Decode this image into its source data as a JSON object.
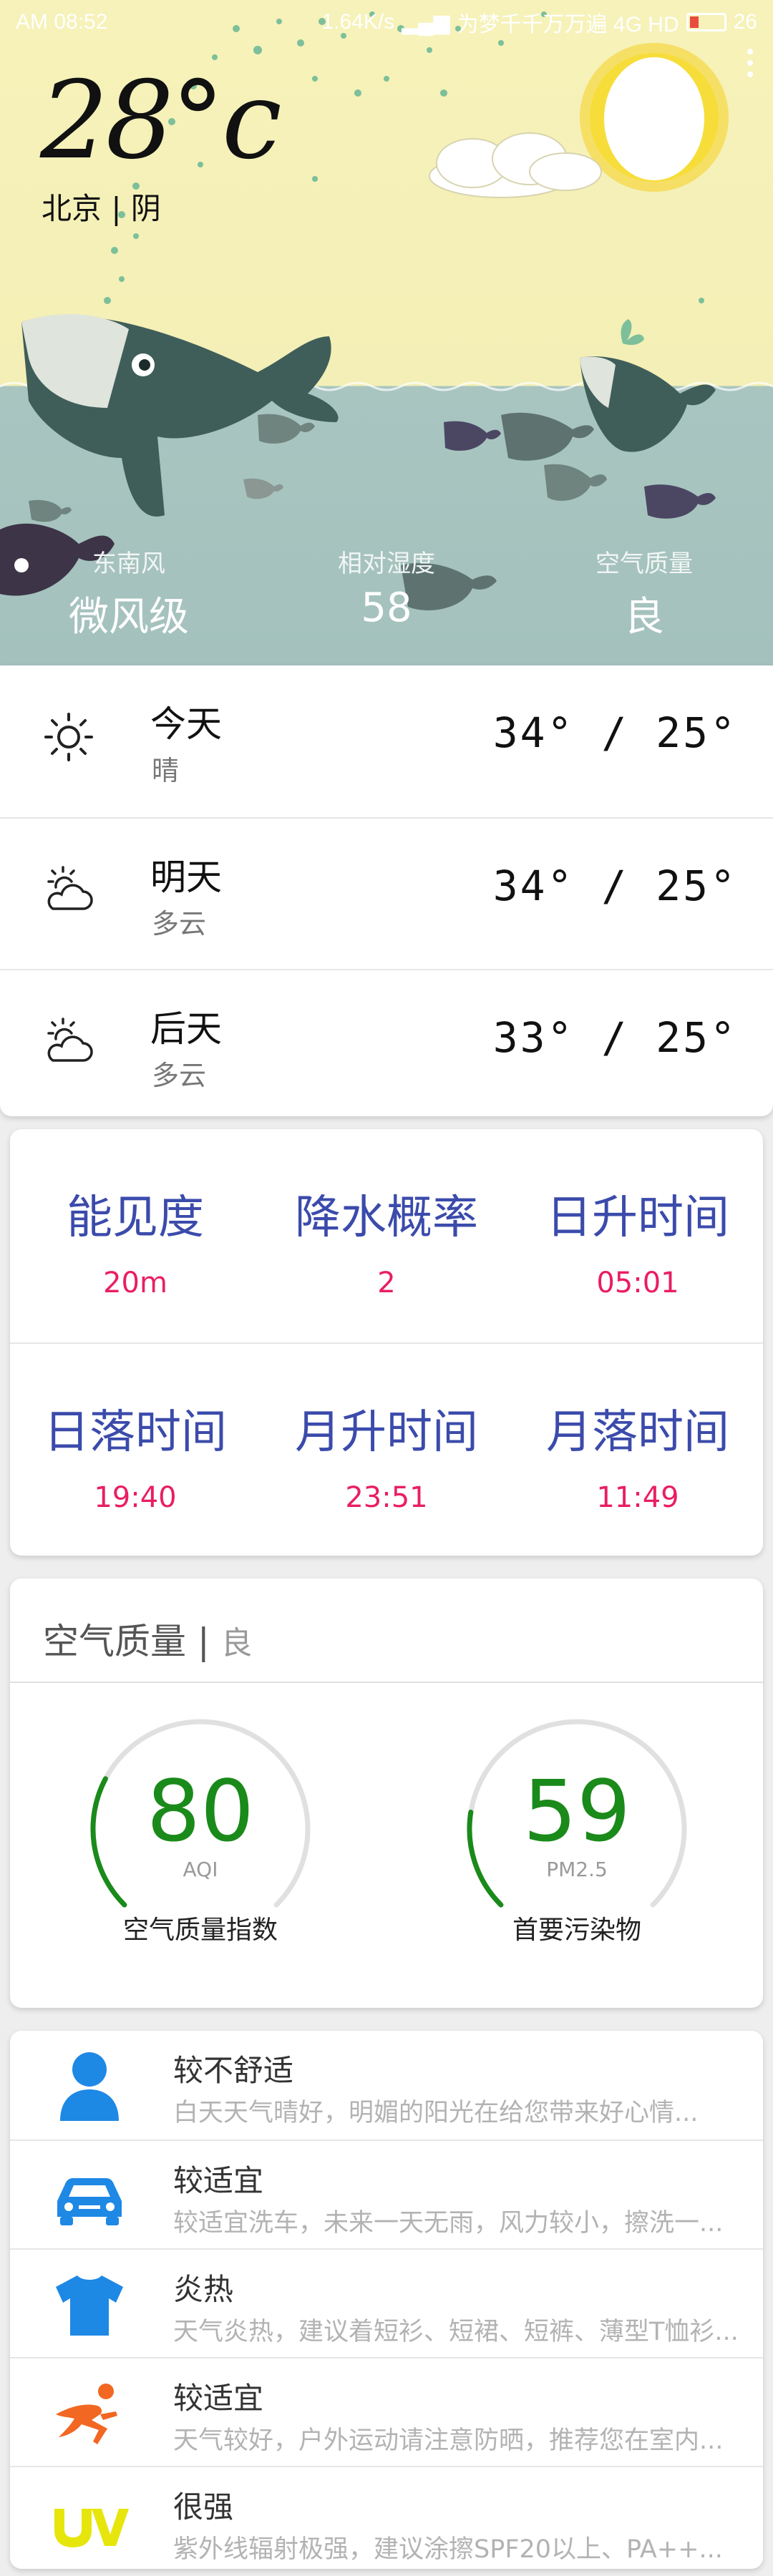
{
  "status_bar": {
    "left": "AM 08:52",
    "speed": "1.64K/s",
    "carrier": "为梦千千万万遍 4G HD",
    "battery": "26"
  },
  "current": {
    "temperature": "28°c",
    "location": "北京 | 阴"
  },
  "hero_stats": [
    {
      "label": "东南风",
      "value": "微风级"
    },
    {
      "label": "相对湿度",
      "value": "58"
    },
    {
      "label": "空气质量",
      "value": "良"
    }
  ],
  "forecast": [
    {
      "day": "今天",
      "desc": "晴",
      "temps": "34° / 25°",
      "icon": "sun-icon"
    },
    {
      "day": "明天",
      "desc": "多云",
      "temps": "34° / 25°",
      "icon": "partly-cloudy-icon"
    },
    {
      "day": "后天",
      "desc": "多云",
      "temps": "33° / 25°",
      "icon": "partly-cloudy-icon"
    }
  ],
  "details": [
    {
      "label": "能见度",
      "value": "20m"
    },
    {
      "label": "降水概率",
      "value": "2"
    },
    {
      "label": "日升时间",
      "value": "05:01"
    },
    {
      "label": "日落时间",
      "value": "19:40"
    },
    {
      "label": "月升时间",
      "value": "23:51"
    },
    {
      "label": "月落时间",
      "value": "11:49"
    }
  ],
  "air_quality": {
    "title": "空气质量",
    "separator": "|",
    "level": "良",
    "aqi": {
      "value": "80",
      "unit": "AQI",
      "caption": "空气质量指数",
      "fraction": 0.27
    },
    "pm25": {
      "value": "59",
      "unit": "PM2.5",
      "caption": "首要污染物",
      "fraction": 0.2
    }
  },
  "life_index": [
    {
      "icon": "person-icon",
      "title": "较不舒适",
      "desc": "白天天气晴好，明媚的阳光在给您带来好心情..."
    },
    {
      "icon": "car-icon",
      "title": "较适宜",
      "desc": "较适宜洗车，未来一天无雨，风力较小，擦洗一..."
    },
    {
      "icon": "tshirt-icon",
      "title": "炎热",
      "desc": "天气炎热，建议着短衫、短裙、短裤、薄型T恤衫..."
    },
    {
      "icon": "runner-icon",
      "title": "较适宜",
      "desc": "天气较好，户外运动请注意防晒，推荐您在室内..."
    },
    {
      "icon": "uv-icon",
      "title": "很强",
      "desc": "紫外线辐射极强，建议涂擦SPF20以上、PA++..."
    }
  ],
  "colors": {
    "accent_blue": "#3b4bab",
    "accent_pink": "#e91e63",
    "gauge_green": "#1a8a1a",
    "icon_blue": "#1e88e5"
  }
}
